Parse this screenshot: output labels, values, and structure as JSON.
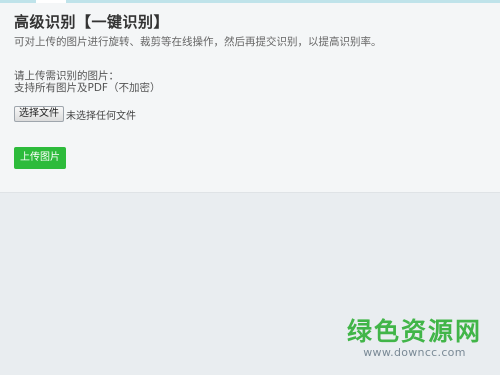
{
  "header": {
    "title": "高级识别【一键识别】",
    "description": "可对上传的图片进行旋转、裁剪等在线操作，然后再提交识别，以提高识别率。"
  },
  "upload": {
    "prompt_line1": "请上传需识别的图片：",
    "prompt_line2": "支持所有图片及PDF（不加密）",
    "choose_file_label": "选择文件",
    "no_file_text": "未选择任何文件",
    "upload_button_label": "上传图片"
  },
  "watermark": {
    "title": "绿色资源网",
    "url": "www.downcc.com"
  },
  "colors": {
    "upload_button": "#2dbb3b",
    "watermark_green": "#41b548"
  }
}
